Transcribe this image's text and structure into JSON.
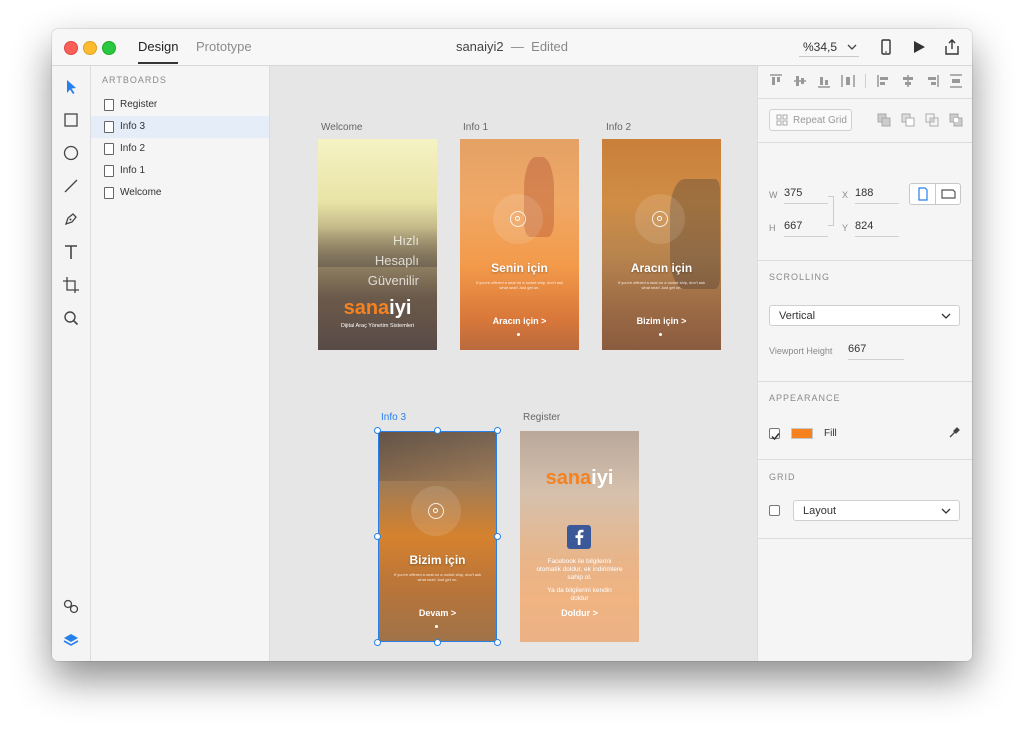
{
  "window": {
    "tabs": [
      {
        "label": "Design",
        "active": true
      },
      {
        "label": "Prototype",
        "active": false
      }
    ],
    "document_name": "sanaiyi2",
    "separator": "—",
    "status": "Edited",
    "zoom": "%34,5"
  },
  "toolbar_icons": [
    "select-arrow",
    "rectangle",
    "ellipse",
    "line",
    "pen",
    "text",
    "artboard",
    "zoom",
    "symbols",
    "layers"
  ],
  "layers_panel": {
    "header": "ARTBOARDS",
    "items": [
      {
        "label": "Register",
        "selected": false
      },
      {
        "label": "Info 3",
        "selected": true
      },
      {
        "label": "Info 2",
        "selected": false
      },
      {
        "label": "Info 1",
        "selected": false
      },
      {
        "label": "Welcome",
        "selected": false
      }
    ]
  },
  "canvas": {
    "artboards": {
      "welcome": {
        "label": "Welcome",
        "lines": [
          "Hızlı",
          "Hesaplı",
          "Güvenilir"
        ],
        "brand_a": "sana",
        "brand_b": "iyi",
        "tagline": "Dijital Araç Yönetim Sistemleri"
      },
      "info1": {
        "label": "Info 1",
        "title": "Senin için",
        "body": "If you're offered a seat on a rocket ship, don't ask what seat! Just get on.",
        "cta": "Aracın için >"
      },
      "info2": {
        "label": "Info 2",
        "title": "Aracın için",
        "body": "If you're offered a seat on a rocket ship, don't ask what seat! Just get on.",
        "cta": "Bizim için >"
      },
      "info3": {
        "label": "Info 3",
        "title": "Bizim için",
        "body": "If you're offered a seat on a rocket ship, don't ask what seat! Just get on.",
        "cta": "Devam >"
      },
      "register": {
        "label": "Register",
        "brand_a": "sana",
        "brand_b": "iyi",
        "fb_text": "Facebook ile bilgilerini otomatik doldur, ek indirimlere sahip ol.",
        "or_text": "Ya da bilgilerini kendin doldur",
        "cta": "Doldur >"
      }
    }
  },
  "properties": {
    "repeat_grid": "Repeat Grid",
    "w_label": "W",
    "w": "375",
    "x_label": "X",
    "x": "188",
    "h_label": "H",
    "h": "667",
    "y_label": "Y",
    "y": "824",
    "scrolling_title": "SCROLLING",
    "scrolling_value": "Vertical",
    "viewport_label": "Viewport Height",
    "viewport_value": "667",
    "appearance_title": "APPEARANCE",
    "fill_label": "Fill",
    "fill_color": "#f5821f",
    "fill_checked": true,
    "grid_title": "GRID",
    "grid_value": "Layout",
    "grid_checked": false
  },
  "colors": {
    "accent": "#2680eb",
    "brand_orange": "#f5821f"
  }
}
